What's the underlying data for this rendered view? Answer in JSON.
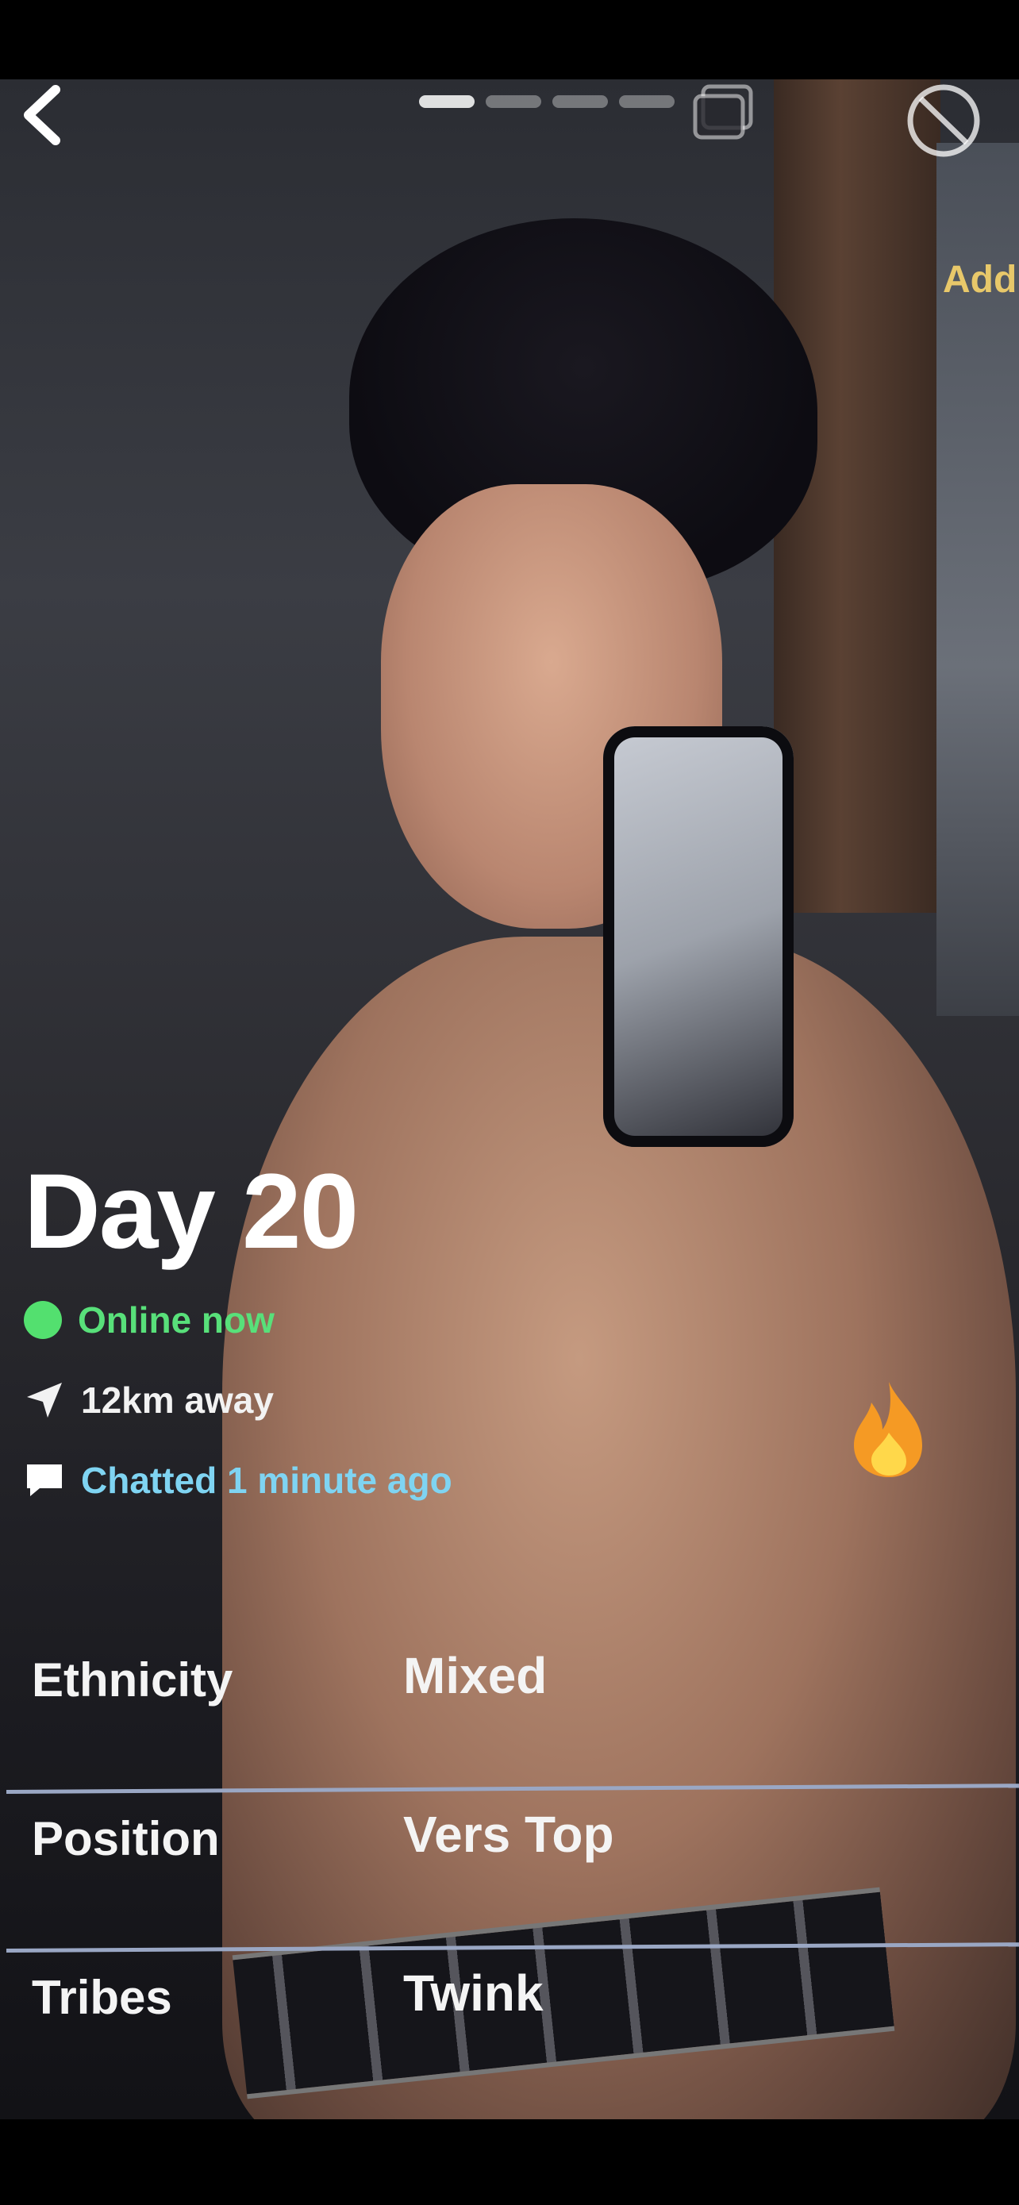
{
  "header": {
    "back_icon": "chevron-left-icon",
    "photo_count": 4,
    "active_photo_index": 0,
    "gallery_icon": "gallery-icon",
    "block_icon": "block-icon"
  },
  "next_profile": {
    "add_label": "Add"
  },
  "profile": {
    "display_name": "Day 20",
    "status": "Online now",
    "distance": "12km away",
    "last_chat": "Chatted 1 minute ago",
    "fire_icon": "fire-icon"
  },
  "stats": [
    {
      "label": "Ethnicity",
      "value": "Mixed"
    },
    {
      "label": "Position",
      "value": "Vers Top"
    },
    {
      "label": "Tribes",
      "value": "Twink"
    }
  ],
  "colors": {
    "online": "#58e07a",
    "chat": "#7fd4f2",
    "divider": "#9aa7c4"
  }
}
